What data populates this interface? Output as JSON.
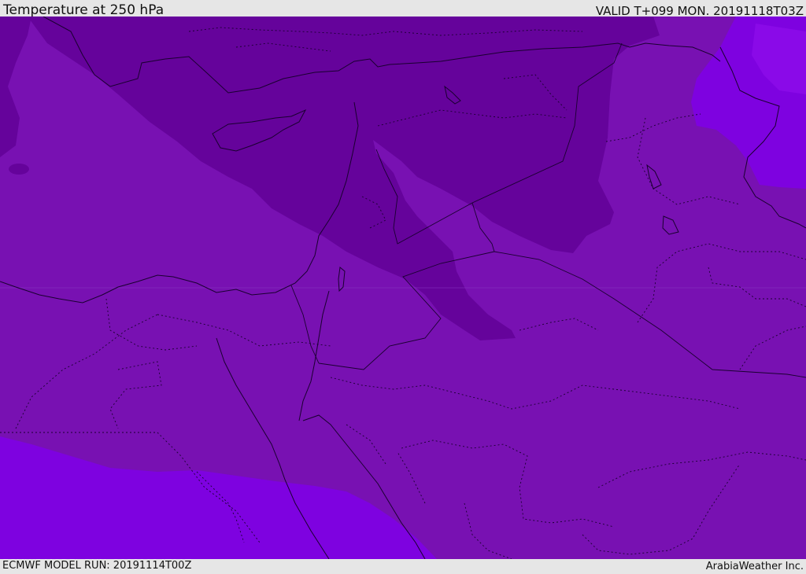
{
  "header": {
    "title": "Temperature at 250 hPa",
    "valid": "VALID T+099 MON. 20191118T03Z"
  },
  "footer": {
    "model_run": "ECMWF MODEL RUN: 20191114T00Z",
    "credit": "ArabiaWeather Inc."
  },
  "map": {
    "colors": {
      "base": "#7811b2",
      "cold": "#65039b",
      "warm": "#7e02e0",
      "warmer": "#8a0ae8",
      "lines": "#1a0030"
    }
  }
}
